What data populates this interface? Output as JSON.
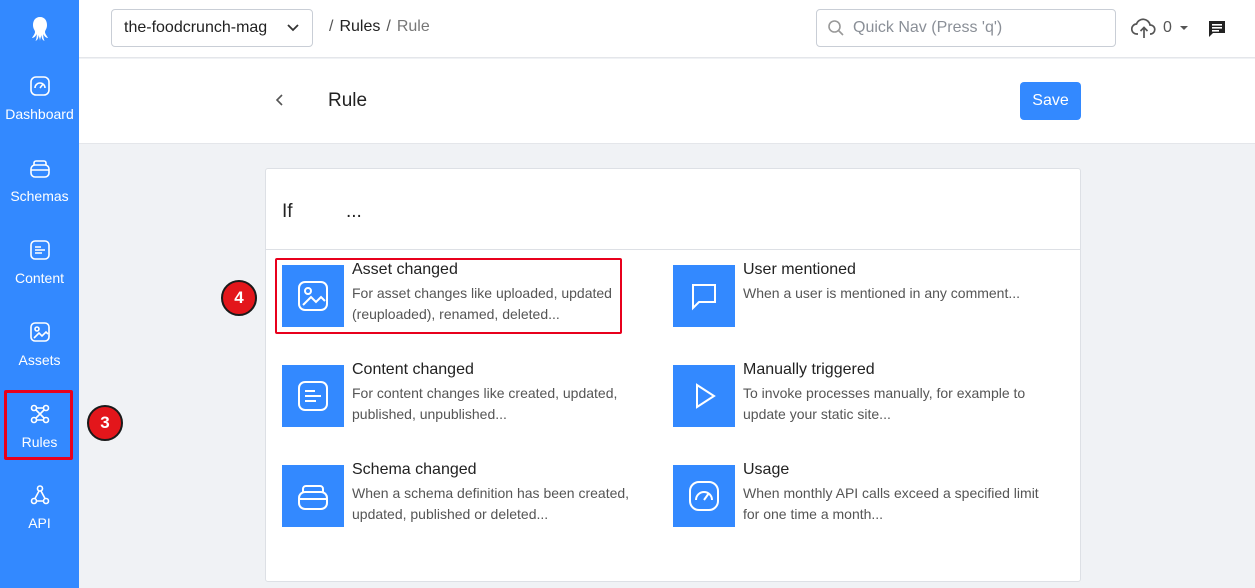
{
  "sidebar": {
    "items": [
      {
        "label": "Dashboard",
        "icon": "dashboard-icon"
      },
      {
        "label": "Schemas",
        "icon": "schemas-icon"
      },
      {
        "label": "Content",
        "icon": "content-icon"
      },
      {
        "label": "Assets",
        "icon": "assets-icon"
      },
      {
        "label": "Rules",
        "icon": "rules-icon"
      },
      {
        "label": "API",
        "icon": "api-icon"
      }
    ]
  },
  "topbar": {
    "app_name": "the-foodcrunch-mag",
    "breadcrumb": {
      "sep1": "/",
      "rules": "Rules",
      "sep2": "/",
      "current": "Rule"
    },
    "search_placeholder": "Quick Nav (Press 'q')",
    "upload_count": "0"
  },
  "header": {
    "title": "Rule",
    "save_label": "Save"
  },
  "card": {
    "if_label": "If",
    "if_dots": "...",
    "triggers": [
      {
        "title": "Asset changed",
        "desc": "For asset changes like uploaded, updated (reuploaded), renamed, deleted...",
        "icon": "image-icon"
      },
      {
        "title": "User mentioned",
        "desc": "When a user is mentioned in any comment...",
        "icon": "comment-icon"
      },
      {
        "title": "Content changed",
        "desc": "For content changes like created, updated, published, unpublished...",
        "icon": "content-icon"
      },
      {
        "title": "Manually triggered",
        "desc": "To invoke processes manually, for example to update your static site...",
        "icon": "play-icon"
      },
      {
        "title": "Schema changed",
        "desc": "When a schema definition has been created, updated, published or deleted...",
        "icon": "schema-icon"
      },
      {
        "title": "Usage",
        "desc": "When monthly API calls exceed a specified limit for one time a month...",
        "icon": "gauge-icon"
      }
    ]
  },
  "annotations": {
    "step3": "3",
    "step4": "4"
  },
  "colors": {
    "accent": "#3389ff",
    "highlight": "#e8001c"
  }
}
